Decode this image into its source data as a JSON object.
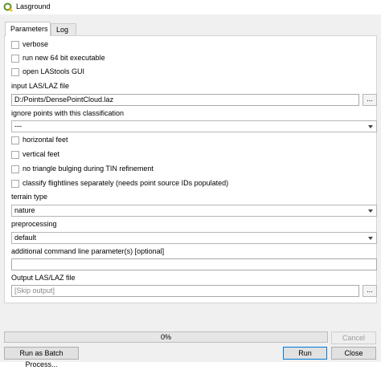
{
  "window": {
    "title": "Lasground",
    "icon": "qgis-logo-icon"
  },
  "tabs": [
    {
      "label": "Parameters",
      "active": true
    },
    {
      "label": "Log",
      "active": false
    }
  ],
  "params": {
    "verbose": "verbose",
    "run64": "run new 64 bit executable",
    "open_gui": "open LAStools GUI",
    "input_label": "input LAS/LAZ file",
    "input_value": "D:/Points/DensePointCloud.laz",
    "browse_label": "...",
    "ignore_label": "ignore points with this classification",
    "ignore_value": "---",
    "horizontal_feet": "horizontal feet",
    "vertical_feet": "vertical feet",
    "no_bulging": "no triangle bulging during TIN refinement",
    "classify_flightlines": "classify flightlines separately (needs point source IDs populated)",
    "terrain_label": "terrain type",
    "terrain_value": "nature",
    "preprocessing_label": "preprocessing",
    "preprocessing_value": "default",
    "additional_label": "additional command line parameter(s) [optional]",
    "additional_value": "",
    "output_label": "Output LAS/LAZ file",
    "output_placeholder": "[Skip output]"
  },
  "progress": {
    "text": "0%",
    "value": 0
  },
  "buttons": {
    "cancel": "Cancel",
    "batch": "Run as Batch Process...",
    "run": "Run",
    "close": "Close"
  }
}
